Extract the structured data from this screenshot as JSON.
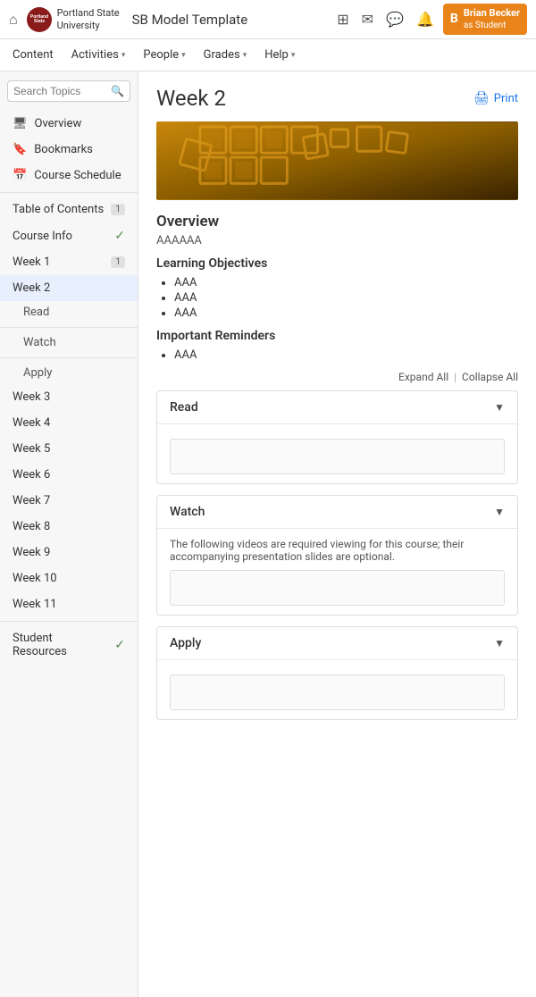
{
  "topNav": {
    "homeIcon": "⌂",
    "logoText": "Portland\nState\nUniversity",
    "siteTitle": "SB Model Template",
    "icons": {
      "grid": "⊞",
      "mail": "✉",
      "chat": "💬",
      "bell": "🔔"
    },
    "user": {
      "initial": "B",
      "name": "Brian Becker",
      "role": "as Student"
    }
  },
  "subNav": {
    "items": [
      {
        "label": "Content",
        "hasDropdown": false
      },
      {
        "label": "Activities",
        "hasDropdown": true
      },
      {
        "label": "People",
        "hasDropdown": true
      },
      {
        "label": "Grades",
        "hasDropdown": true
      },
      {
        "label": "Help",
        "hasDropdown": true
      }
    ]
  },
  "sidebar": {
    "searchPlaceholder": "Search Topics",
    "items": [
      {
        "id": "overview",
        "label": "Overview",
        "icon": "monitor",
        "badge": null,
        "check": false
      },
      {
        "id": "bookmarks",
        "label": "Bookmarks",
        "icon": "bookmark",
        "badge": null,
        "check": false
      },
      {
        "id": "schedule",
        "label": "Course Schedule",
        "icon": "calendar",
        "badge": null,
        "check": false
      },
      {
        "id": "toc",
        "label": "Table of Contents",
        "icon": null,
        "badge": "1",
        "check": false
      },
      {
        "id": "courseinfo",
        "label": "Course Info",
        "icon": null,
        "badge": null,
        "check": true
      },
      {
        "id": "week1",
        "label": "Week 1",
        "icon": null,
        "badge": "1",
        "check": false
      },
      {
        "id": "week2",
        "label": "Week 2",
        "icon": null,
        "badge": null,
        "check": false,
        "active": true
      },
      {
        "id": "week3",
        "label": "Week 3",
        "icon": null,
        "badge": null,
        "check": false
      },
      {
        "id": "week4",
        "label": "Week 4",
        "icon": null,
        "badge": null,
        "check": false
      },
      {
        "id": "week5",
        "label": "Week 5",
        "icon": null,
        "badge": null,
        "check": false
      },
      {
        "id": "week6",
        "label": "Week 6",
        "icon": null,
        "badge": null,
        "check": false
      },
      {
        "id": "week7",
        "label": "Week 7",
        "icon": null,
        "badge": null,
        "check": false
      },
      {
        "id": "week8",
        "label": "Week 8",
        "icon": null,
        "badge": null,
        "check": false
      },
      {
        "id": "week9",
        "label": "Week 9",
        "icon": null,
        "badge": null,
        "check": false
      },
      {
        "id": "week10",
        "label": "Week 10",
        "icon": null,
        "badge": null,
        "check": false
      },
      {
        "id": "week11",
        "label": "Week 11",
        "icon": null,
        "badge": null,
        "check": false
      },
      {
        "id": "studentresources",
        "label": "Student Resources",
        "icon": null,
        "badge": null,
        "check": true
      }
    ],
    "subItems": [
      {
        "id": "read",
        "label": "Read"
      },
      {
        "id": "watch",
        "label": "Watch"
      },
      {
        "id": "apply",
        "label": "Apply"
      }
    ]
  },
  "main": {
    "pageTitle": "Week 2",
    "printLabel": "Print",
    "overview": {
      "title": "Overview",
      "text": "AAAAAA"
    },
    "learningObjectives": {
      "title": "Learning Objectives",
      "items": [
        "AAA",
        "AAA",
        "AAA"
      ]
    },
    "importantReminders": {
      "title": "Important Reminders",
      "items": [
        "AAA"
      ]
    },
    "expandAll": "Expand All",
    "collapseAll": "Collapse All",
    "accordions": [
      {
        "id": "read",
        "label": "Read",
        "body": "",
        "hasNote": false
      },
      {
        "id": "watch",
        "label": "Watch",
        "body": "The following videos are required viewing for this course; their accompanying presentation slides are optional.",
        "hasNote": true
      },
      {
        "id": "apply",
        "label": "Apply",
        "body": "",
        "hasNote": false
      }
    ]
  }
}
